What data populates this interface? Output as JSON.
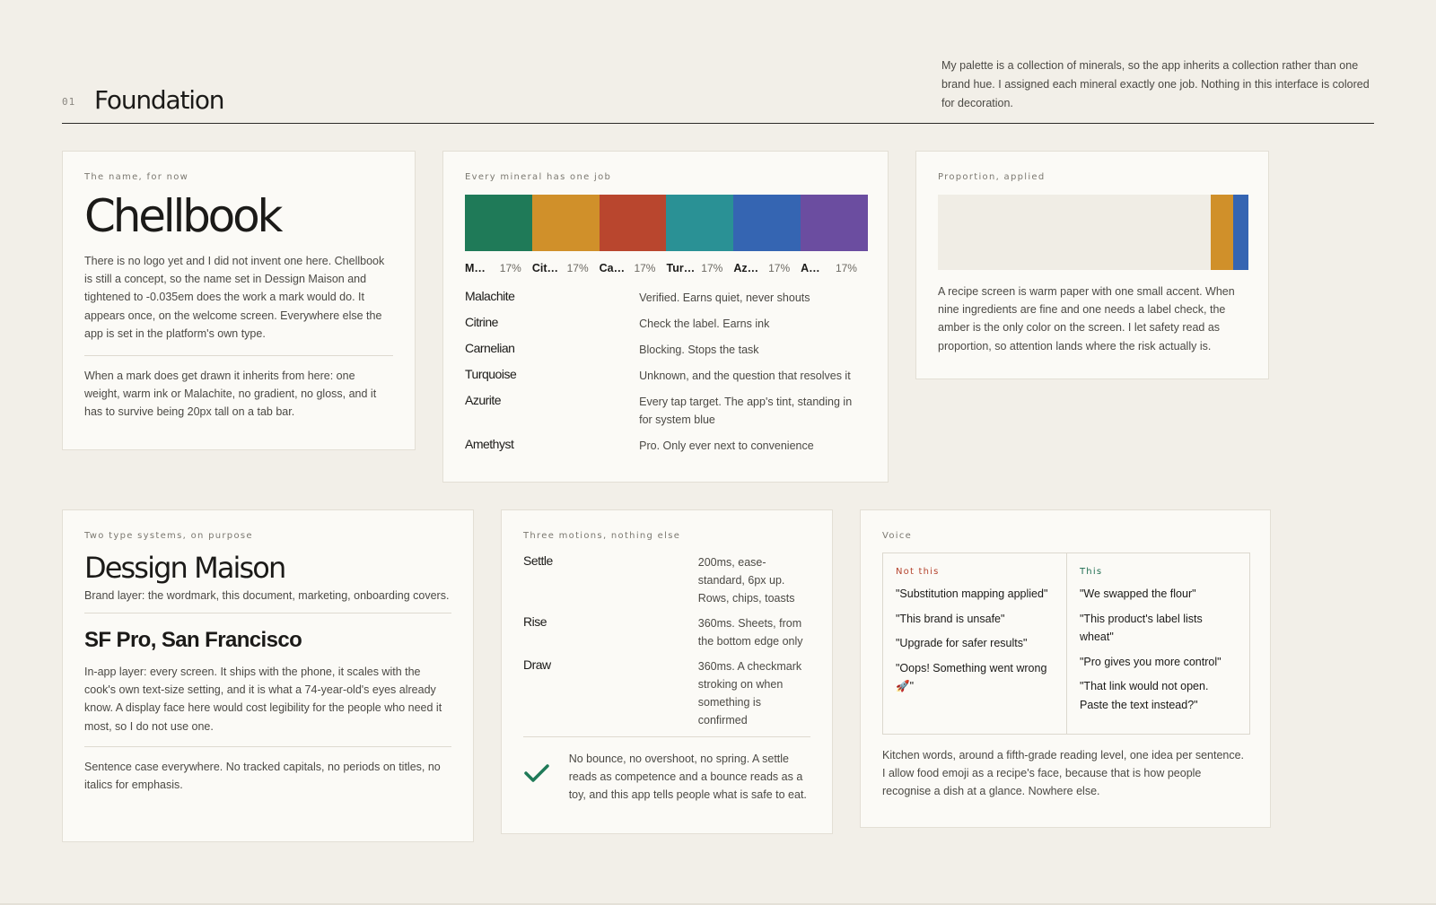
{
  "header": {
    "section_number": "01",
    "title": "Foundation",
    "intro": "My palette is a collection of minerals, so the app inherits a collection rather than one brand hue. I assigned each mineral exactly one job. Nothing in this interface is colored for decoration."
  },
  "name_card": {
    "eyebrow": "The name, for now",
    "brand": "Chellbook",
    "p1": "There is no logo yet and I did not invent one here. Chellbook is still a concept, so the name set in Dessign Maison and tightened to -0.035em does the work a mark would do. It appears once, on the welcome screen. Everywhere else the app is set in the platform's own type.",
    "p2": "When a mark does get drawn it inherits from here: one weight, warm ink or Malachite, no gradient, no gloss, and it has to survive being 20px tall on a tab bar."
  },
  "minerals_card": {
    "eyebrow": "Every mineral has one job",
    "legend": [
      {
        "short": "M…",
        "pct": "17%"
      },
      {
        "short": "Cit…",
        "pct": "17%"
      },
      {
        "short": "Ca…",
        "pct": "17%"
      },
      {
        "short": "Tur…",
        "pct": "17%"
      },
      {
        "short": "Az…",
        "pct": "17%"
      },
      {
        "short": "A…",
        "pct": "17%"
      }
    ],
    "jobs": [
      {
        "mineral": "Malachite",
        "job": "Verified. Earns quiet, never shouts"
      },
      {
        "mineral": "Citrine",
        "job": "Check the label. Earns ink"
      },
      {
        "mineral": "Carnelian",
        "job": "Blocking. Stops the task"
      },
      {
        "mineral": "Turquoise",
        "job": "Unknown, and the question that resolves it"
      },
      {
        "mineral": "Azurite",
        "job": "Every tap target. The app's tint, standing in for system blue"
      },
      {
        "mineral": "Amethyst",
        "job": "Pro. Only ever next to convenience"
      }
    ],
    "colors": [
      "#1f7a58",
      "#d0902a",
      "#b9462e",
      "#2a9195",
      "#3565b2",
      "#6b4da0"
    ]
  },
  "proportion_card": {
    "eyebrow": "Proportion, applied",
    "body": "A recipe screen is warm paper with one small accent. When nine ingredients are fine and one needs a label check, the amber is the only color on the screen. I let safety read as proportion, so attention lands where the risk actually is."
  },
  "type_card": {
    "eyebrow": "Two type systems, on purpose",
    "brand_face": "Dessign Maison",
    "brand_caption": "Brand layer: the wordmark, this document, marketing, onboarding covers.",
    "system_face": "SF Pro, San Francisco",
    "system_body": "In-app layer: every screen. It ships with the phone, it scales with the cook's own text-size setting, and it is what a 74-year-old's eyes already know. A display face here would cost legibility for the people who need it most, so I do not use one.",
    "rules": "Sentence case everywhere. No tracked capitals, no periods on titles, no italics for emphasis."
  },
  "motion_card": {
    "eyebrow": "Three motions, nothing else",
    "motions": [
      {
        "name": "Settle",
        "desc": "200ms, ease-standard, 6px up. Rows, chips, toasts"
      },
      {
        "name": "Rise",
        "desc": "360ms. Sheets, from the bottom edge only"
      },
      {
        "name": "Draw",
        "desc": "360ms. A checkmark stroking on when something is confirmed"
      }
    ],
    "note": "No bounce, no overshoot, no spring. A settle reads as competence and a bounce reads as a toy, and this app tells people what is safe to eat.",
    "check_color": "#1f7a58"
  },
  "voice_card": {
    "eyebrow": "Voice",
    "not_this_label": "Not this",
    "this_label": "This",
    "not_this": [
      "\"Substitution mapping applied\"",
      "\"This brand is unsafe\"",
      "\"Upgrade for safer results\"",
      "\"Oops! Something went wrong 🚀\""
    ],
    "this": [
      "\"We swapped the flour\"",
      "\"This product's label lists wheat\"",
      "\"Pro gives you more control\"",
      "\"That link would not open. Paste the text instead?\""
    ],
    "body": "Kitchen words, around a fifth-grade reading level, one idea per sentence. I allow food emoji as a recipe's face, because that is how people recognise a dish at a glance. Nowhere else."
  }
}
